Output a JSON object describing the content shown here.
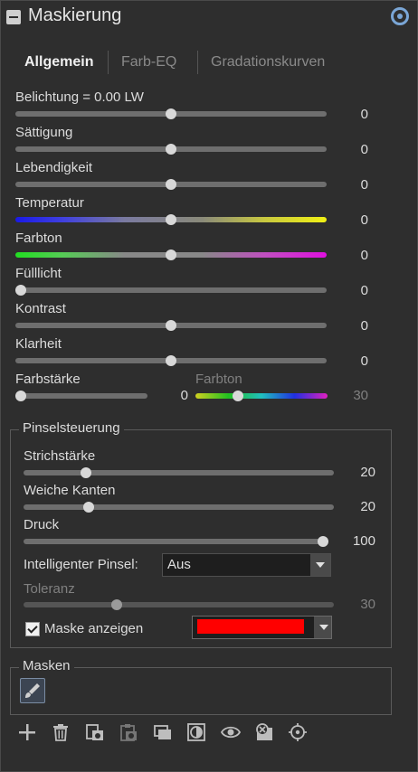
{
  "header": {
    "title": "Maskierung"
  },
  "tabs": [
    {
      "label": "Allgemein",
      "active": true
    },
    {
      "label": "Farb-EQ",
      "active": false
    },
    {
      "label": "Gradationskurven",
      "active": false
    }
  ],
  "sliders": [
    {
      "label": "Belichtung = 0.00 LW",
      "value": "0",
      "position": 0.5
    },
    {
      "label": "Sättigung",
      "value": "0",
      "position": 0.5
    },
    {
      "label": "Lebendigkeit",
      "value": "0",
      "position": 0.5
    },
    {
      "label": "Temperatur",
      "value": "0",
      "position": 0.5
    },
    {
      "label": "Farbton",
      "value": "0",
      "position": 0.5
    },
    {
      "label": "Fülllicht",
      "value": "0",
      "position": 0.0
    },
    {
      "label": "Kontrast",
      "value": "0",
      "position": 0.5
    },
    {
      "label": "Klarheit",
      "value": "0",
      "position": 0.5
    }
  ],
  "farbstaerke": {
    "label": "Farbstärke",
    "value": "0",
    "position": 0.0
  },
  "farbton2": {
    "label": "Farbton",
    "value": "30",
    "position": 0.32
  },
  "brush": {
    "group_title": "Pinselsteuerung",
    "strichstaerke": {
      "label": "Strichstärke",
      "value": "20",
      "position": 0.2
    },
    "weiche_kanten": {
      "label": "Weiche Kanten",
      "value": "20",
      "position": 0.21
    },
    "druck": {
      "label": "Druck",
      "value": "100",
      "position": 1.0
    },
    "intelligent_label": "Intelligenter Pinsel:",
    "intelligent_value": "Aus",
    "toleranz": {
      "label": "Toleranz",
      "value": "30",
      "position": 0.3
    },
    "show_mask_label": "Maske anzeigen",
    "show_mask_checked": true,
    "mask_color": "#ff0000"
  },
  "masks": {
    "group_title": "Masken"
  },
  "toolbar": [
    {
      "name": "add-icon",
      "glyph": "+"
    },
    {
      "name": "trash-icon",
      "glyph": "🗑"
    },
    {
      "name": "copy-mask-icon",
      "glyph": "⧉"
    },
    {
      "name": "paste-mask-icon",
      "glyph": "📋"
    },
    {
      "name": "duplicate-icon",
      "glyph": "▣"
    },
    {
      "name": "invert-icon",
      "glyph": "◐"
    },
    {
      "name": "eye-icon",
      "glyph": "👁"
    },
    {
      "name": "clear-mask-icon",
      "glyph": "⊗"
    },
    {
      "name": "target-icon",
      "glyph": "⌖"
    }
  ]
}
